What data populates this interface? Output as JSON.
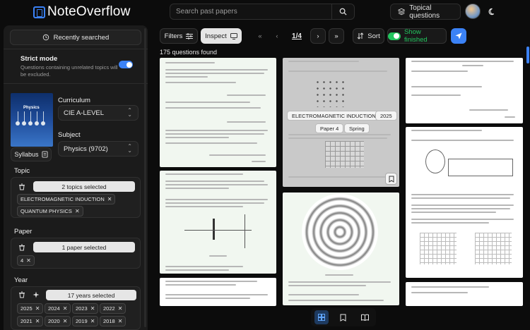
{
  "brand": {
    "name": "NoteOverflow"
  },
  "search": {
    "placeholder": "Search past papers"
  },
  "header": {
    "topical_label": "Topical questions"
  },
  "sidebar": {
    "recently_searched": "Recently searched",
    "strict_mode": {
      "title": "Strict mode",
      "description": "Questions containing unrelated topics will be excluded.",
      "enabled": true
    },
    "book": {
      "title": "Physics"
    },
    "curriculum": {
      "label": "Curriculum",
      "value": "CIE A-LEVEL"
    },
    "subject": {
      "label": "Subject",
      "value": "Physics (9702)"
    },
    "syllabus_label": "Syllabus",
    "topic": {
      "label": "Topic",
      "summary": "2 topics selected",
      "chips": [
        "ELECTROMAGNETIC INDUCTION",
        "QUANTUM PHYSICS"
      ]
    },
    "paper": {
      "label": "Paper",
      "summary": "1 paper selected",
      "chips": [
        "4"
      ]
    },
    "year": {
      "label": "Year",
      "summary": "17 years selected",
      "chips": [
        "2025",
        "2024",
        "2023",
        "2022",
        "2021",
        "2020",
        "2019",
        "2018"
      ]
    }
  },
  "toolbar": {
    "filters": "Filters",
    "inspect": "Inspect",
    "page": "1/4",
    "sort": "Sort",
    "show_finished": "Show finished"
  },
  "results": {
    "count_text": "175 questions found"
  },
  "preview": {
    "topic": "ELECTROMAGNETIC INDUCTION",
    "year": "2025",
    "paper": "Paper 4",
    "season": "Spring"
  },
  "colors": {
    "accent": "#3b82f6",
    "success": "#22c55e"
  }
}
